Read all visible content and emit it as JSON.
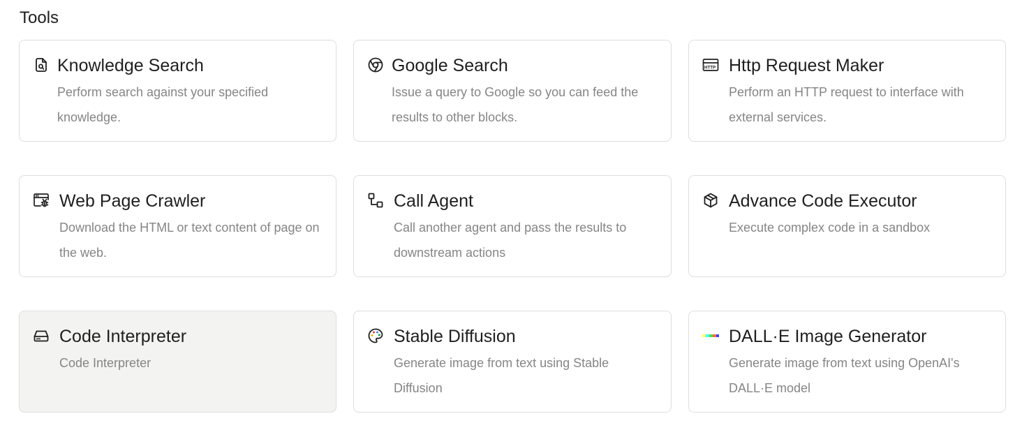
{
  "section": {
    "title": "Tools"
  },
  "tools": [
    {
      "name": "knowledge-search",
      "icon": "file-search-icon",
      "title": "Knowledge Search",
      "description": "Perform search against your specified knowledge."
    },
    {
      "name": "google-search",
      "icon": "chrome-icon",
      "title": "Google Search",
      "description": "Issue a query to Google so you can feed the results to other blocks."
    },
    {
      "name": "http-request-maker",
      "icon": "http-icon",
      "title": "Http Request Maker",
      "description": "Perform an HTTP request to interface with external services."
    },
    {
      "name": "web-page-crawler",
      "icon": "browser-bug-icon",
      "title": "Web Page Crawler",
      "description": "Download the HTML or text content of page on the web."
    },
    {
      "name": "call-agent",
      "icon": "agent-flow-icon",
      "title": "Call Agent",
      "description": "Call another agent and pass the results to downstream actions"
    },
    {
      "name": "advance-code-executor",
      "icon": "package-icon",
      "title": "Advance Code Executor",
      "description": "Execute complex code in a sandbox"
    },
    {
      "name": "code-interpreter",
      "icon": "hard-drive-icon",
      "title": "Code Interpreter",
      "description": "Code Interpreter",
      "selected": true
    },
    {
      "name": "stable-diffusion",
      "icon": "palette-icon",
      "title": "Stable Diffusion",
      "description": "Generate image from text using Stable Diffusion"
    },
    {
      "name": "dall-e-image-generator",
      "icon": "dalle-logo-icon",
      "title": "DALL·E Image Generator",
      "description": "Generate image from text using OpenAI's DALL·E model"
    }
  ]
}
